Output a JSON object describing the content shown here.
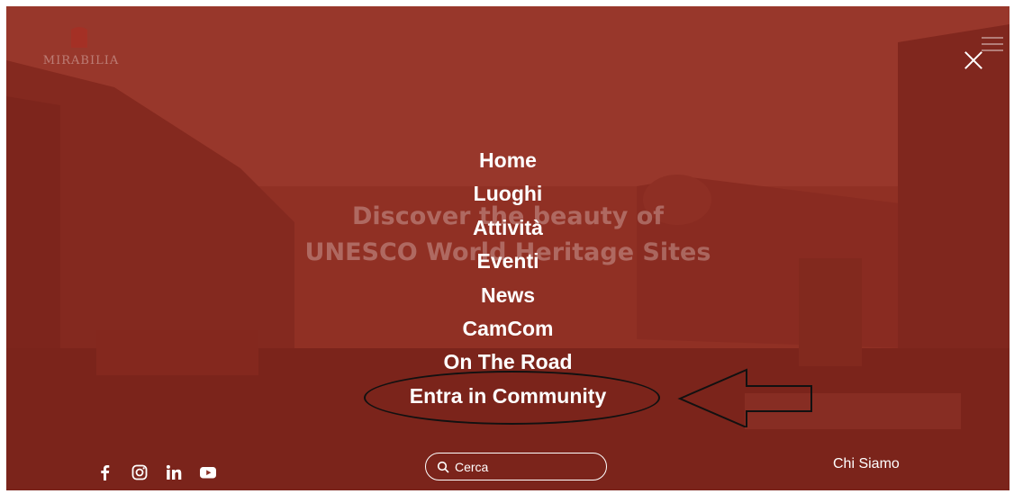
{
  "brand": {
    "logo_text": "MIRABILIA"
  },
  "hero": {
    "line1": "Discover the beauty of",
    "line2": "UNESCO World Heritage Sites"
  },
  "menu": {
    "items": [
      {
        "label": "Home"
      },
      {
        "label": "Luoghi"
      },
      {
        "label": "Attività"
      },
      {
        "label": "Eventi"
      },
      {
        "label": "News"
      },
      {
        "label": "CamCom"
      },
      {
        "label": "On The Road"
      },
      {
        "label": "Entra in Community"
      }
    ],
    "highlighted_item": "Entra in Community"
  },
  "social": {
    "icons": [
      "facebook-icon",
      "instagram-icon",
      "linkedin-icon",
      "youtube-icon"
    ]
  },
  "search": {
    "placeholder": "Cerca"
  },
  "footer": {
    "about_link": "Chi Siamo"
  },
  "colors": {
    "overlay": "#9a3226",
    "text": "#ffffff",
    "annotation": "#111111"
  }
}
